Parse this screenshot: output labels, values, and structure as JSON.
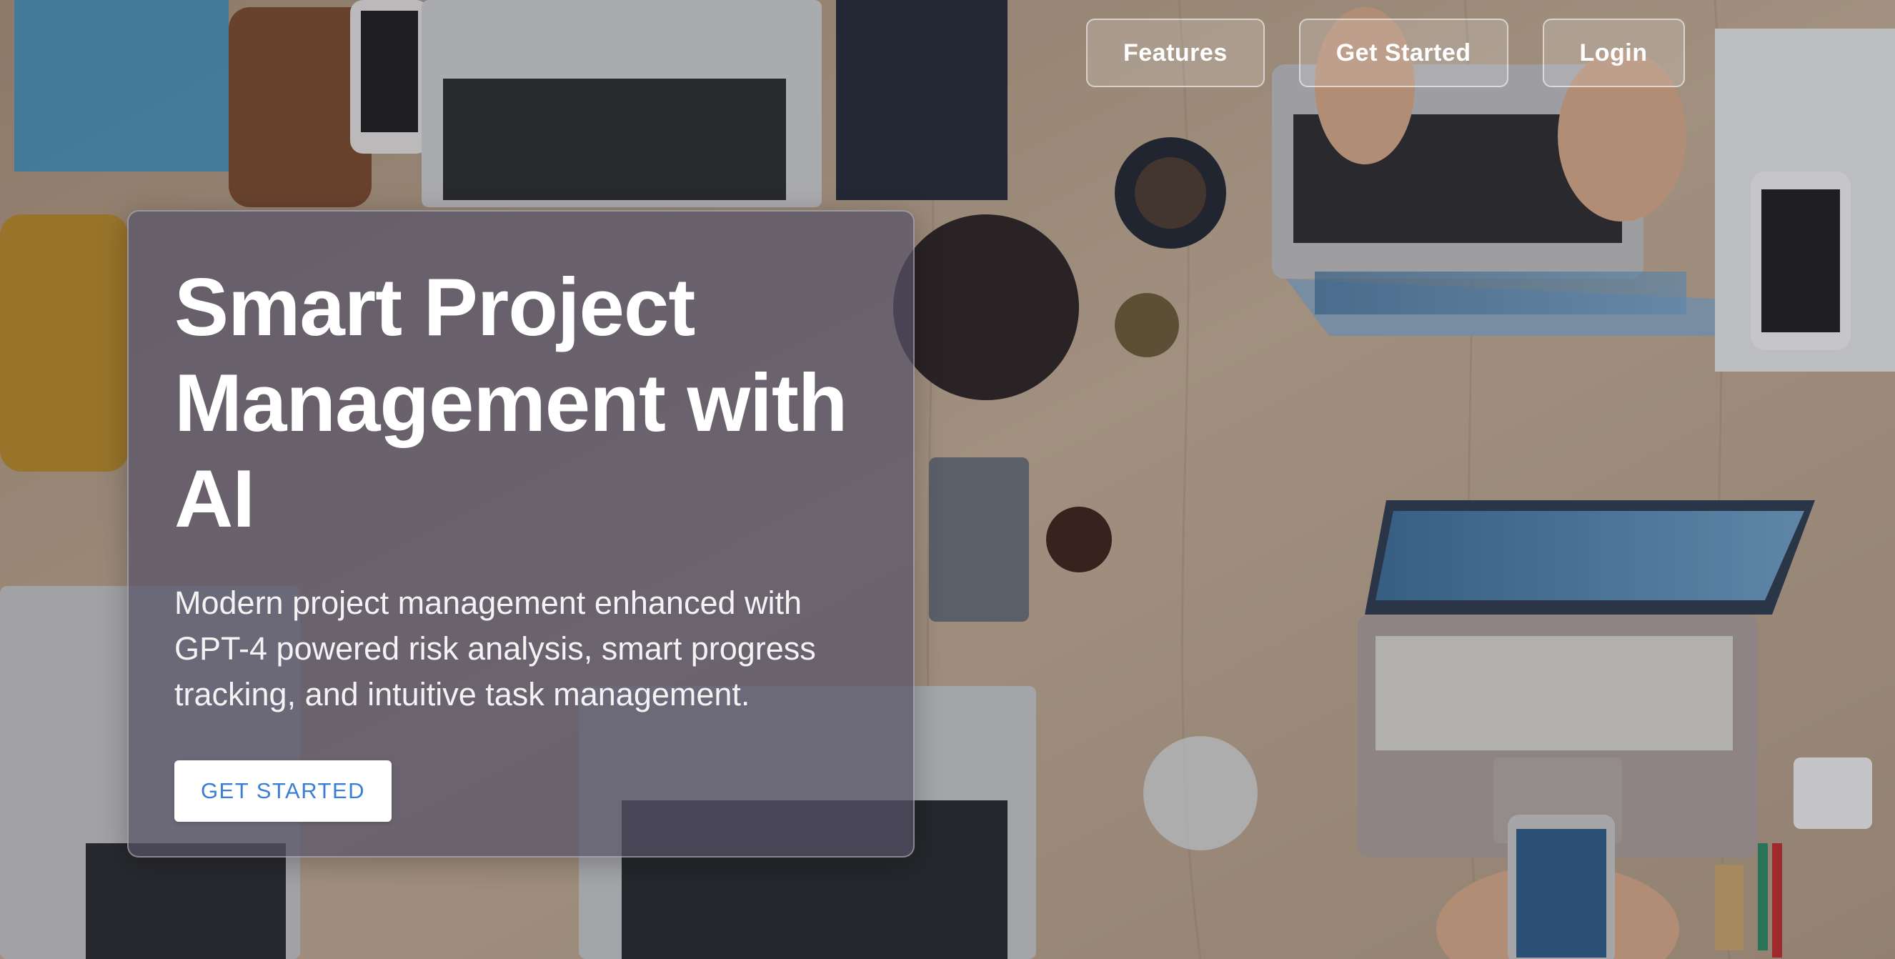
{
  "nav": {
    "features_label": "Features",
    "get_started_label": "Get Started",
    "login_label": "Login"
  },
  "hero": {
    "title": "Smart Project Management with AI",
    "subtitle": "Modern project management enhanced with GPT-4 powered risk analysis, smart progress tracking, and intuitive task management.",
    "cta_label": "GET STARTED"
  },
  "colors": {
    "cta_text": "#3a7fd6",
    "card_bg": "#565266",
    "desk": "#b9a48d"
  }
}
